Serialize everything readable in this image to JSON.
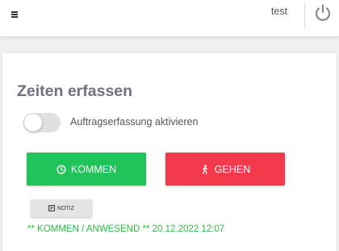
{
  "header": {
    "menu_icon": "hamburger-icon",
    "username": "test",
    "power_icon": "power-icon"
  },
  "card": {
    "title": "Zeiten erfassen",
    "toggle": {
      "label": "Auftragserfassung aktivieren",
      "checked": false
    },
    "kommen_button": {
      "label": "KOMMEN",
      "icon": "clock-icon",
      "color": "#1fc55a"
    },
    "gehen_button": {
      "label": "GEHEN",
      "icon": "walking-person-icon",
      "color": "#f33a4c"
    },
    "notiz_button": {
      "label": "NOTIZ",
      "icon": "note-icon"
    },
    "status": "** KOMMEN / ANWESEND ** 20.12.2022 12:07",
    "status_color": "#2dbb41"
  }
}
